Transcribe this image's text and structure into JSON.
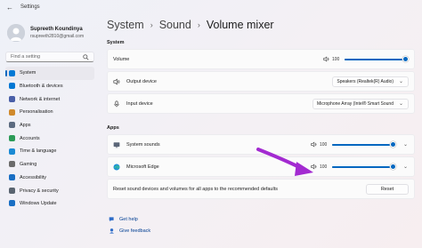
{
  "window": {
    "title": "Settings",
    "back_icon": "back-arrow-icon"
  },
  "profile": {
    "name": "Supreeth Koundinya",
    "email": "rsupreeth2810@gmail.com"
  },
  "search": {
    "placeholder": "Find a setting"
  },
  "sidebar": {
    "items": [
      {
        "label": "System",
        "icon": "system-icon",
        "color": "#0078d4",
        "active": true
      },
      {
        "label": "Bluetooth & devices",
        "icon": "bluetooth-icon",
        "color": "#0078d4"
      },
      {
        "label": "Network & internet",
        "icon": "network-icon",
        "color": "#4a5fa8"
      },
      {
        "label": "Personalisation",
        "icon": "brush-icon",
        "color": "#d08a2c"
      },
      {
        "label": "Apps",
        "icon": "apps-icon",
        "color": "#5c6b80"
      },
      {
        "label": "Accounts",
        "icon": "accounts-icon",
        "color": "#2b9b57"
      },
      {
        "label": "Time & language",
        "icon": "time-language-icon",
        "color": "#1a8ad4"
      },
      {
        "label": "Gaming",
        "icon": "gaming-icon",
        "color": "#6b6b6b"
      },
      {
        "label": "Accessibility",
        "icon": "accessibility-icon",
        "color": "#1a6fc4"
      },
      {
        "label": "Privacy & security",
        "icon": "shield-icon",
        "color": "#5a6470"
      },
      {
        "label": "Windows Update",
        "icon": "windows-update-icon",
        "color": "#1a6fc4"
      }
    ]
  },
  "breadcrumb": {
    "first": "System",
    "second": "Sound",
    "current": "Volume mixer",
    "separator": "›"
  },
  "system": {
    "section_label": "System",
    "volume": {
      "label": "Volume",
      "value": "100",
      "level": 1.0,
      "icon": "speaker-icon"
    },
    "output": {
      "label": "Output device",
      "selected": "Speakers (Realtek(R) Audio)",
      "icon": "speaker-output-icon"
    },
    "input": {
      "label": "Input device",
      "selected": "Microphone Array (Intel® Smart Sound",
      "icon": "microphone-icon"
    }
  },
  "apps": {
    "section_label": "Apps",
    "rows": [
      {
        "label": "System sounds",
        "value": "100",
        "level": 1.0,
        "icon": "system-sounds-icon"
      },
      {
        "label": "Microsoft Edge",
        "value": "100",
        "level": 1.0,
        "icon": "edge-icon"
      }
    ],
    "reset": {
      "text": "Reset sound devices and volumes for all apps to the recommended defaults",
      "button": "Reset"
    }
  },
  "help": {
    "get_help": "Get help",
    "give_feedback": "Give feedback"
  },
  "colors": {
    "accent": "#0067c0",
    "annotation_arrow": "#a32ad1"
  }
}
